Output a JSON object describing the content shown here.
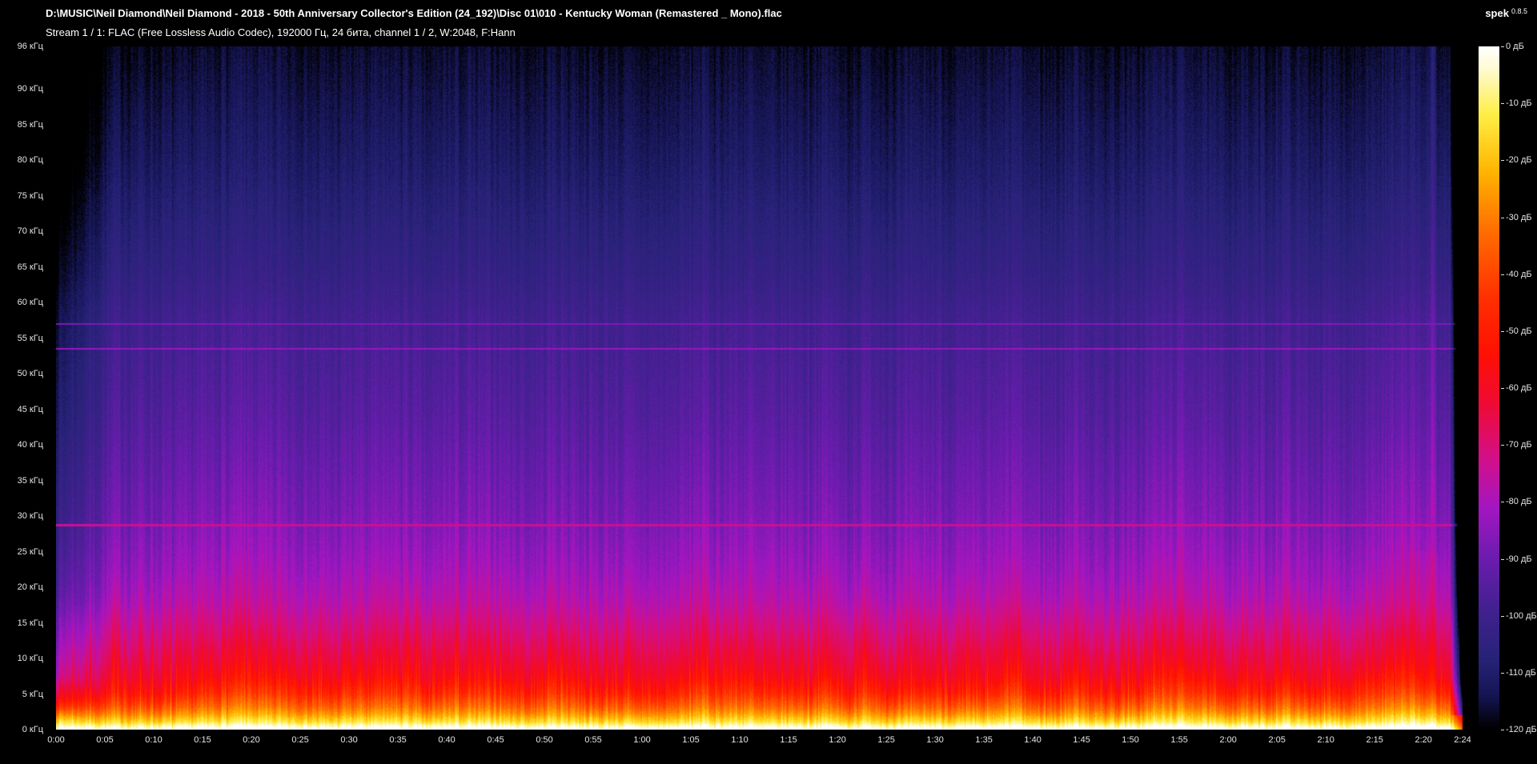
{
  "window": {
    "title": "D:\\MUSIC\\Neil Diamond\\Neil Diamond - 2018 - 50th Anniversary Collector's Edition (24_192)\\Disc 01\\010 - Kentucky Woman (Remastered _ Mono).flac",
    "app_name": "spek",
    "app_version": "0.8.5",
    "stream_info": "Stream 1 / 1: FLAC (Free Lossless Audio Codec), 192000 Гц, 24 бита, channel 1 / 2, W:2048, F:Hann"
  },
  "colors": {
    "background": "#000000",
    "title_text": "#ffffff",
    "axis_text": "#e6e6e6"
  },
  "chart_data": {
    "type": "heatmap",
    "title": "Audio spectrogram",
    "x_axis": {
      "unit": "min:sec",
      "duration_seconds": 144,
      "duration_label": "2:24",
      "tick_interval_seconds": 5,
      "ticks": [
        "0:00",
        "0:05",
        "0:10",
        "0:15",
        "0:20",
        "0:25",
        "0:30",
        "0:35",
        "0:40",
        "0:45",
        "0:50",
        "0:55",
        "1:00",
        "1:05",
        "1:10",
        "1:15",
        "1:20",
        "1:25",
        "1:30",
        "1:35",
        "1:40",
        "1:45",
        "1:50",
        "1:55",
        "2:00",
        "2:05",
        "2:10",
        "2:15",
        "2:20",
        "2:24"
      ]
    },
    "y_axis": {
      "unit": "кГц",
      "min_khz": 0,
      "max_khz": 96,
      "ticks": [
        "96 кГц",
        "90 кГц",
        "85 кГц",
        "80 кГц",
        "75 кГц",
        "70 кГц",
        "65 кГц",
        "60 кГц",
        "55 кГц",
        "50 кГц",
        "45 кГц",
        "40 кГц",
        "35 кГц",
        "30 кГц",
        "25 кГц",
        "20 кГц",
        "15 кГц",
        "10 кГц",
        "5 кГц",
        "0 кГц"
      ],
      "tick_values_khz": [
        96,
        90,
        85,
        80,
        75,
        70,
        65,
        60,
        55,
        50,
        45,
        40,
        35,
        30,
        25,
        20,
        15,
        10,
        5,
        0
      ]
    },
    "legend": {
      "unit": "дБ",
      "max_db": 0,
      "min_db": -120,
      "tick_interval_db": 10,
      "ticks": [
        "0 дБ",
        "-10 дБ",
        "-20 дБ",
        "-30 дБ",
        "-40 дБ",
        "-50 дБ",
        "-60 дБ",
        "-70 дБ",
        "-80 дБ",
        "-90 дБ",
        "-100 дБ",
        "-110 дБ",
        "-120 дБ"
      ]
    },
    "features": {
      "horizontal_tones_khz": [
        57.0,
        53.5,
        28.7
      ],
      "horizontal_tone_levels_db": [
        -87,
        -83,
        -74
      ],
      "intro_buildup_seconds": 6,
      "broadband_burst_at_seconds": 141,
      "fade_out_after_seconds": 142.8,
      "dense_content_below_khz": 16
    },
    "palette_stops": [
      {
        "db": 0,
        "color": "#ffffff"
      },
      {
        "db": -4,
        "color": "#fffbd0"
      },
      {
        "db": -12,
        "color": "#ffee45"
      },
      {
        "db": -22,
        "color": "#ffb400"
      },
      {
        "db": -32,
        "color": "#ff7000"
      },
      {
        "db": -44,
        "color": "#ff3000"
      },
      {
        "db": -54,
        "color": "#ff1003"
      },
      {
        "db": -63,
        "color": "#ee0a36"
      },
      {
        "db": -72,
        "color": "#d40f86"
      },
      {
        "db": -81,
        "color": "#a416c2"
      },
      {
        "db": -90,
        "color": "#6b1cae"
      },
      {
        "db": -99,
        "color": "#41218f"
      },
      {
        "db": -108,
        "color": "#262276"
      },
      {
        "db": -114,
        "color": "#151553"
      },
      {
        "db": -120,
        "color": "#000000"
      }
    ]
  }
}
